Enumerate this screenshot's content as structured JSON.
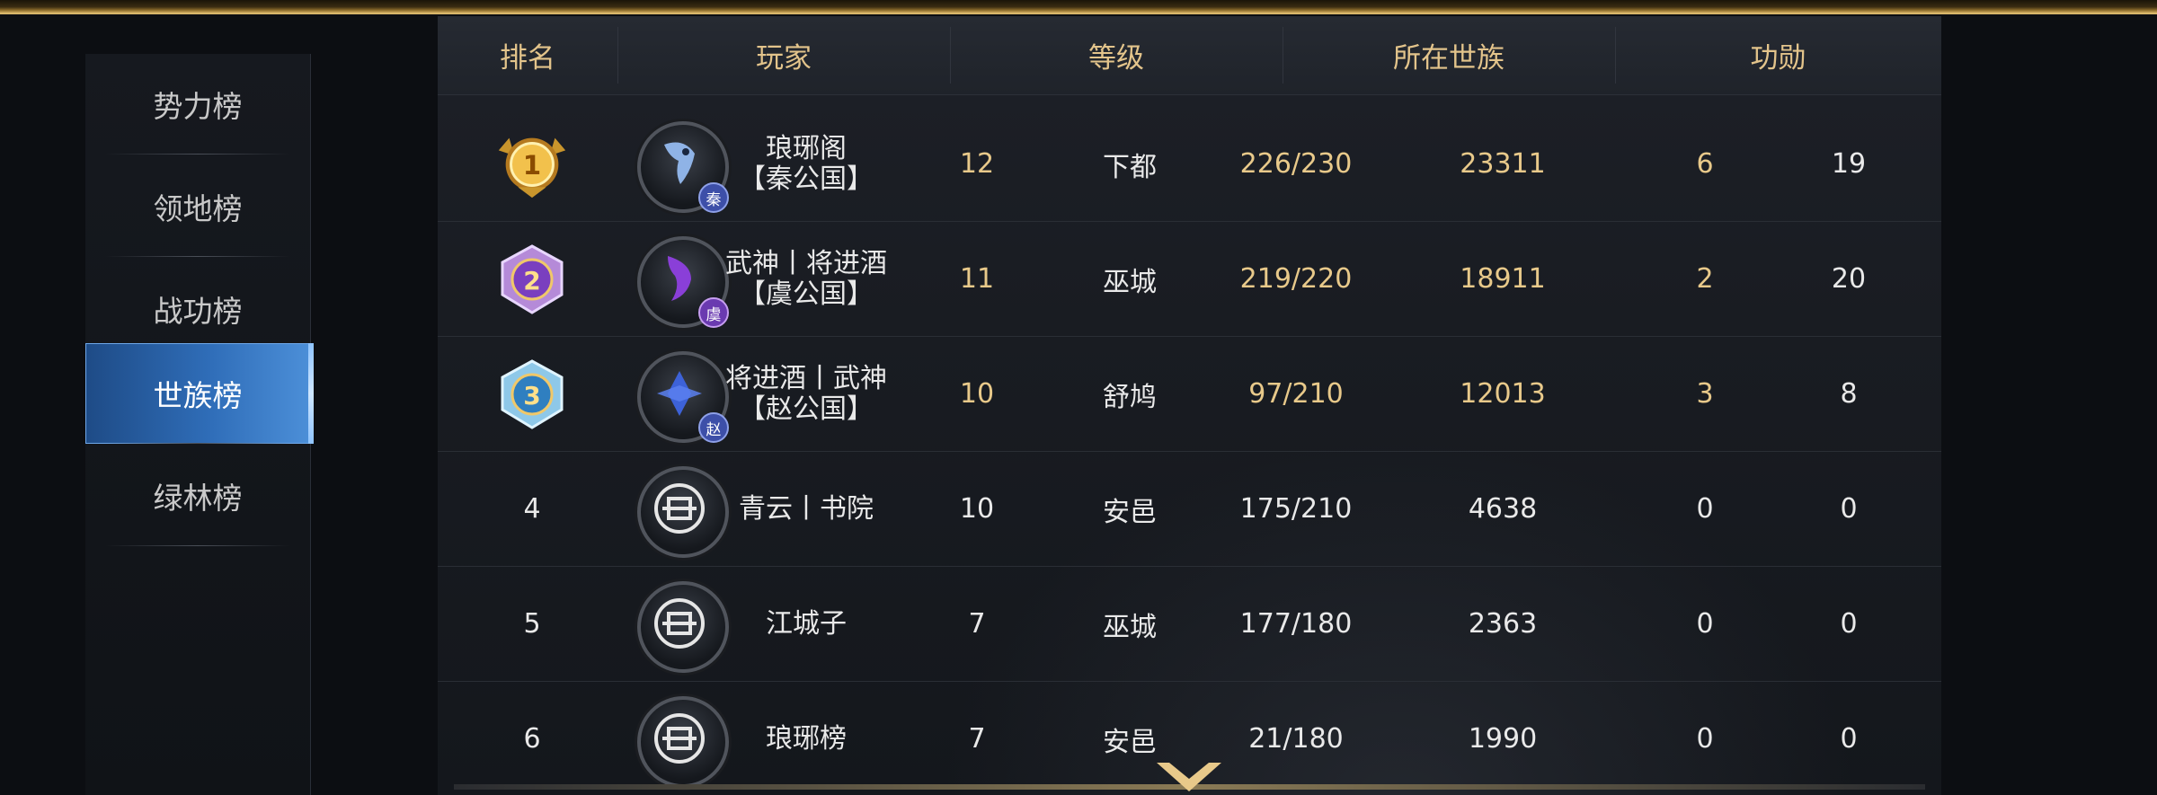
{
  "sidebar": {
    "items": [
      {
        "label": "势力榜"
      },
      {
        "label": "领地榜"
      },
      {
        "label": "战功榜"
      },
      {
        "label": "世族榜"
      },
      {
        "label": "绿林榜"
      }
    ],
    "active": "世族榜"
  },
  "table": {
    "headers": [
      "排名",
      "玩家",
      "等级",
      "所在世族",
      "功勋"
    ],
    "rows": [
      {
        "rank": "1",
        "name1": "琅琊阁",
        "name2": "【秦公国】",
        "seal": "秦",
        "c1": "12",
        "c2": "下都",
        "c3": "226/230",
        "c4": "23311",
        "c5": "6",
        "c6": "19"
      },
      {
        "rank": "2",
        "name1": "武神丨将进酒",
        "name2": "【虞公国】",
        "seal": "虞",
        "c1": "11",
        "c2": "巫城",
        "c3": "219/220",
        "c4": "18911",
        "c5": "2",
        "c6": "20"
      },
      {
        "rank": "3",
        "name1": "将进酒丨武神",
        "name2": "【赵公国】",
        "seal": "赵",
        "c1": "10",
        "c2": "舒鸠",
        "c3": "97/210",
        "c4": "12013",
        "c5": "3",
        "c6": "8"
      },
      {
        "rank": "4",
        "name1": "青云丨书院",
        "name2": "",
        "seal": "",
        "c1": "10",
        "c2": "安邑",
        "c3": "175/210",
        "c4": "4638",
        "c5": "0",
        "c6": "0"
      },
      {
        "rank": "5",
        "name1": "江城子",
        "name2": "",
        "seal": "",
        "c1": "7",
        "c2": "巫城",
        "c3": "177/180",
        "c4": "2363",
        "c5": "0",
        "c6": "0"
      },
      {
        "rank": "6",
        "name1": "琅琊榜",
        "name2": "",
        "seal": "",
        "c1": "7",
        "c2": "安邑",
        "c3": "21/180",
        "c4": "1990",
        "c5": "0",
        "c6": "0"
      }
    ]
  },
  "icons": {
    "medal_1": "gold-medal-icon",
    "medal_2": "purple-medal-icon",
    "medal_3": "blue-medal-icon",
    "clan_default": "clan-emblem-icon",
    "scroll": "chevron-down-icon"
  },
  "colors": {
    "header_text": "#e3c48b",
    "top_rank_text": "#e8c98a",
    "active_tab": "#2f6db8"
  }
}
